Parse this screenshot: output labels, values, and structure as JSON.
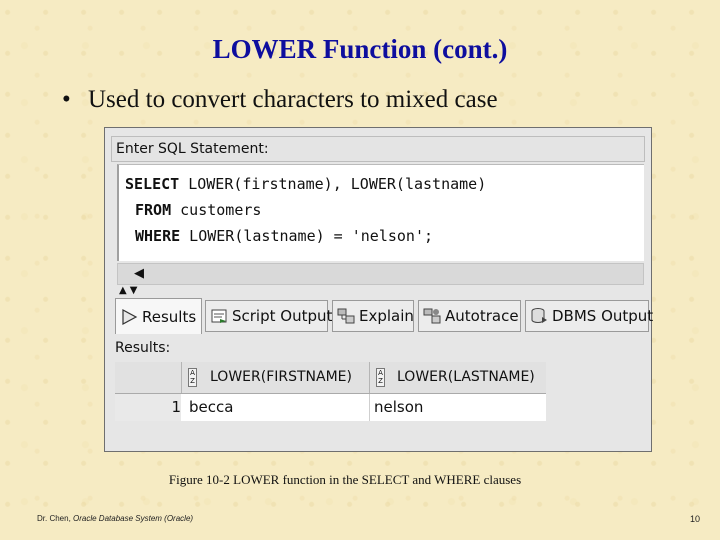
{
  "slide": {
    "title": "LOWER Function (cont.)",
    "bullet": "Used to convert characters to mixed case",
    "caption": "Figure 10-2   LOWER function in the SELECT and WHERE clauses",
    "footer_author": "Dr. Chen, ",
    "footer_course": "Oracle Database System (Oracle)",
    "page_number": "10"
  },
  "sql_panel": {
    "label": "Enter SQL Statement:",
    "lines": [
      {
        "keyword": "SELECT",
        "rest": " LOWER(firstname), LOWER(lastname)"
      },
      {
        "keyword": "FROM",
        "rest": " customers"
      },
      {
        "keyword": "WHERE",
        "rest": " LOWER(lastname) = 'nelson';"
      }
    ]
  },
  "tabs": [
    {
      "label": "Results",
      "icon": "play-icon",
      "active": true
    },
    {
      "label": "Script Output",
      "icon": "script-icon",
      "active": false
    },
    {
      "label": "Explain",
      "icon": "explain-icon",
      "active": false
    },
    {
      "label": "Autotrace",
      "icon": "autotrace-icon",
      "active": false
    },
    {
      "label": "DBMS Output",
      "icon": "dbms-icon",
      "active": false
    }
  ],
  "results": {
    "label": "Results:",
    "columns": [
      "LOWER(FIRSTNAME)",
      "LOWER(LASTNAME)"
    ],
    "rows": [
      {
        "num": "1",
        "cells": [
          "becca",
          "nelson"
        ]
      }
    ]
  },
  "colors": {
    "title": "#0e0e9e",
    "background": "#f6ebc3"
  }
}
